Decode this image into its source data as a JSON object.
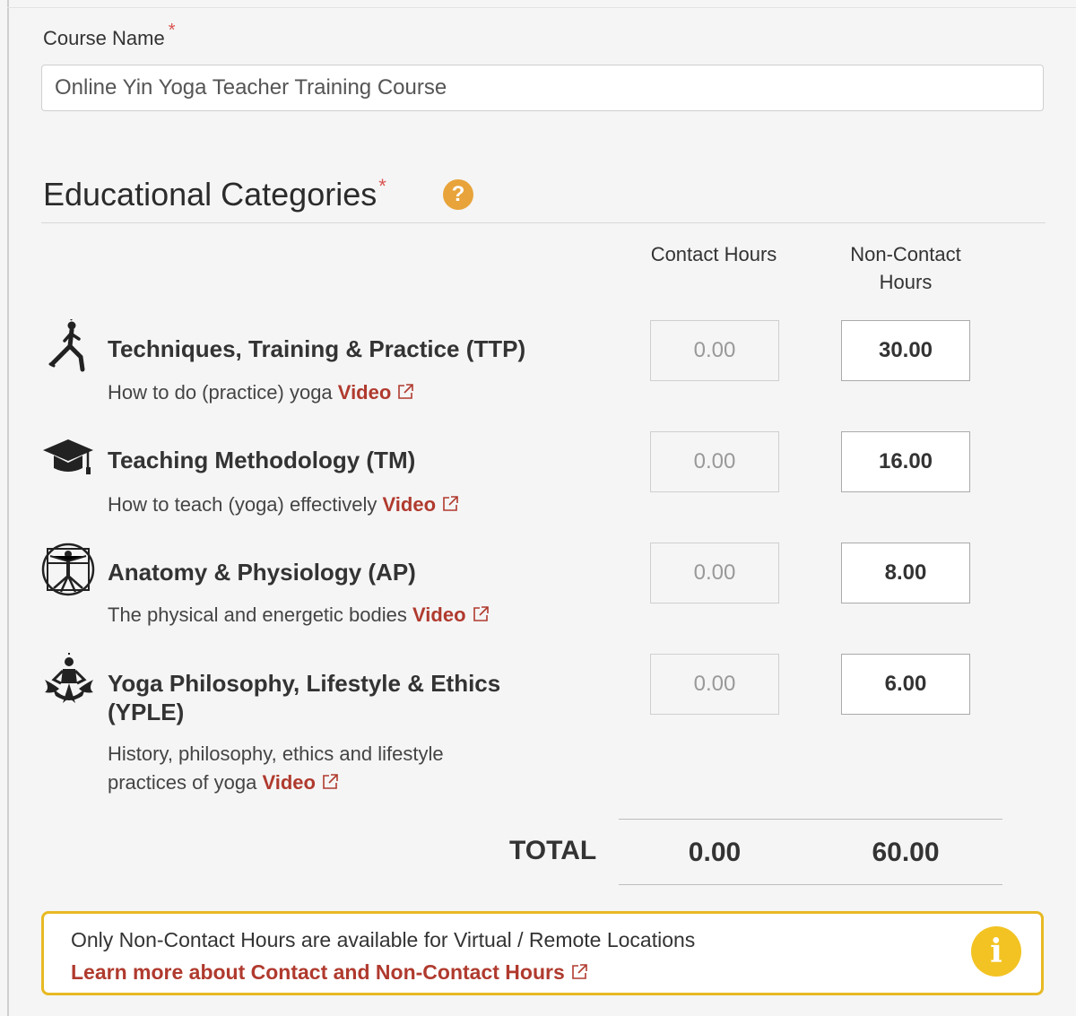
{
  "course": {
    "label": "Course Name",
    "required_mark": "*",
    "value": "Online Yin Yoga Teacher Training Course"
  },
  "section": {
    "title": "Educational Categories",
    "required_mark": "*",
    "help_glyph": "?",
    "help_icon": "question-circle-icon"
  },
  "columns": {
    "contact": "Contact Hours",
    "noncontact_line1": "Non-Contact",
    "noncontact_line2": "Hours"
  },
  "categories": [
    {
      "icon": "yoga-pose-icon",
      "title": "Techniques, Training & Practice (TTP)",
      "desc": "How to do (practice) yoga",
      "link": "Video",
      "contact": "0.00",
      "noncontact": "30.00"
    },
    {
      "icon": "graduation-cap-icon",
      "title": "Teaching Methodology (TM)",
      "desc": "How to teach (yoga) effectively",
      "link": "Video",
      "contact": "0.00",
      "noncontact": "16.00"
    },
    {
      "icon": "vitruvian-man-icon",
      "title": "Anatomy & Physiology (AP)",
      "desc": "The physical and energetic bodies",
      "link": "Video",
      "contact": "0.00",
      "noncontact": "8.00"
    },
    {
      "icon": "lotus-meditation-icon",
      "title_line1": "Yoga Philosophy, Lifestyle & Ethics",
      "title_line2": "(YPLE)",
      "desc_line1": "History, philosophy, ethics and lifestyle",
      "desc_line2": "practices of yoga",
      "link": "Video",
      "contact": "0.00",
      "noncontact": "6.00"
    }
  ],
  "total": {
    "label": "TOTAL",
    "contact": "0.00",
    "noncontact": "60.00"
  },
  "notice": {
    "text": "Only Non-Contact Hours are available for Virtual / Remote Locations",
    "link": "Learn more about Contact and Non-Contact Hours",
    "icon_glyph": "i",
    "icon": "info-circle-icon"
  },
  "colors": {
    "accent_orange": "#e8a33a",
    "link_red": "#b03a2e",
    "required_red": "#d9534f",
    "notice_border": "#e8b923",
    "notice_icon": "#f2c322"
  }
}
